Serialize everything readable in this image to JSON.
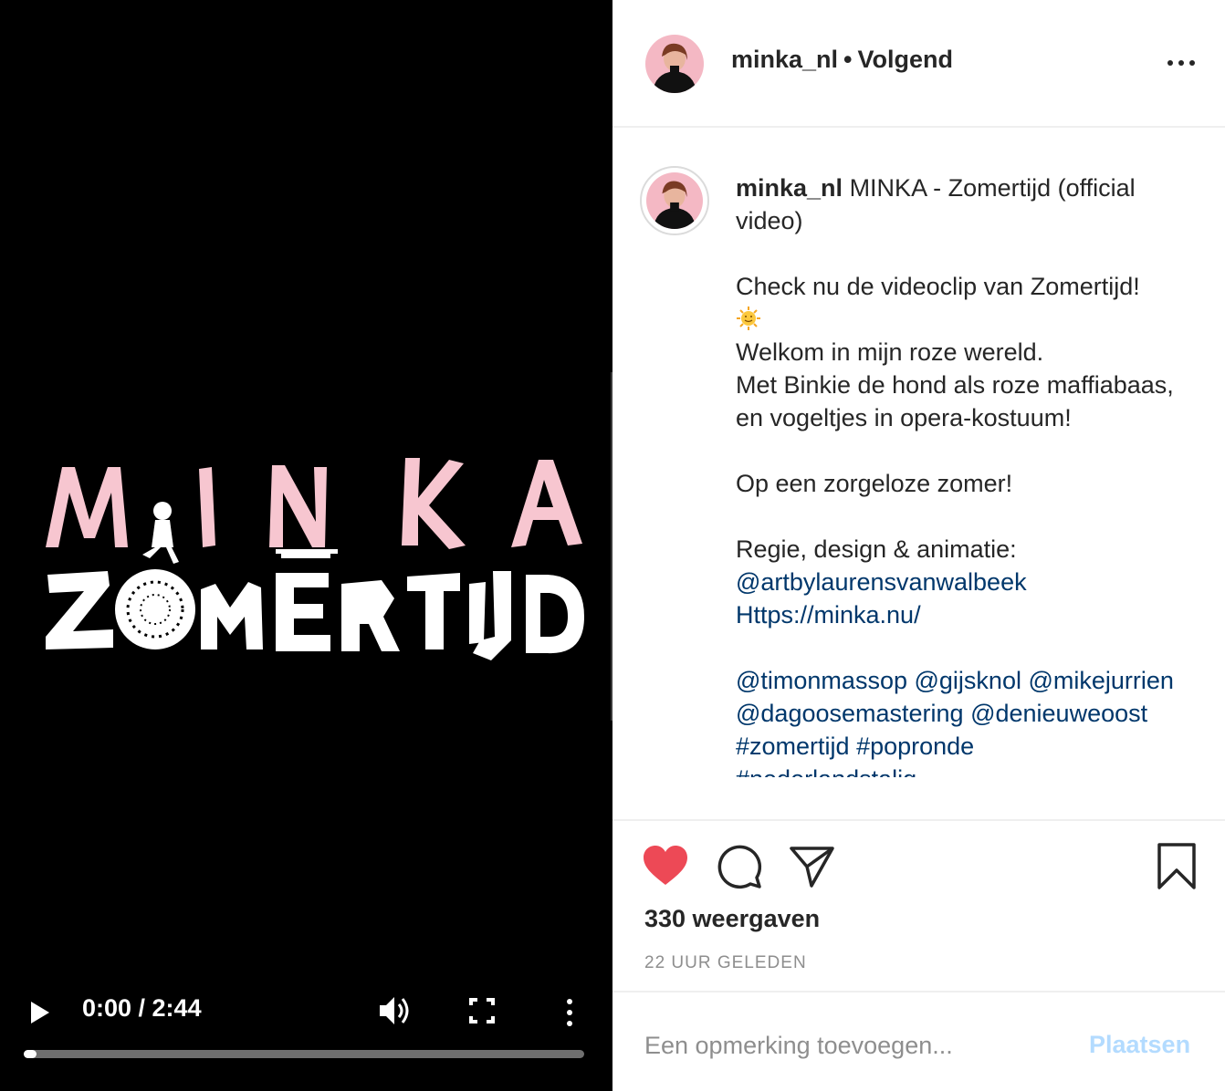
{
  "video": {
    "logo": {
      "artist": "MINKA",
      "title": "ZOMERTIJD"
    },
    "time": "0:00 / 2:44",
    "progress_fraction": 0.0
  },
  "header": {
    "username": "minka_nl",
    "separator": "•",
    "follow_status": "Volgend"
  },
  "caption": {
    "username": "minka_nl",
    "title": "MINKA - Zomertijd (official video)",
    "line1": "Check nu de videoclip van Zomertijd!",
    "emoji": "sun-face",
    "line2": "Welkom in mijn roze wereld.",
    "line3": "Met Binkie de hond als roze maffiabaas, en vogeltjes in opera-kostuum!",
    "line4": "Op een zorgeloze zomer!",
    "line5": "Regie, design & animatie:",
    "link1": "@artbylaurensvanwalbeek",
    "link2": "Https://minka.nu/",
    "mentions": [
      "@timonmassop",
      "@gijsknol",
      "@mikejurrien",
      "@dagoosemastering",
      "@denieuweoost"
    ],
    "hashtags": [
      "#zomertijd",
      "#popronde"
    ],
    "hashtag_cut": "#nederlandstalig"
  },
  "stats": {
    "views": "330 weergaven",
    "time_ago": "22 UUR GELEDEN"
  },
  "comment": {
    "placeholder": "Een opmerking toevoegen...",
    "post_label": "Plaatsen"
  },
  "colors": {
    "like": "#ed4956",
    "link": "#00376b",
    "post_disabled": "#b3dbff",
    "logo_pink": "#f7c6d0",
    "avatar_bg": "#f4b8c4"
  }
}
